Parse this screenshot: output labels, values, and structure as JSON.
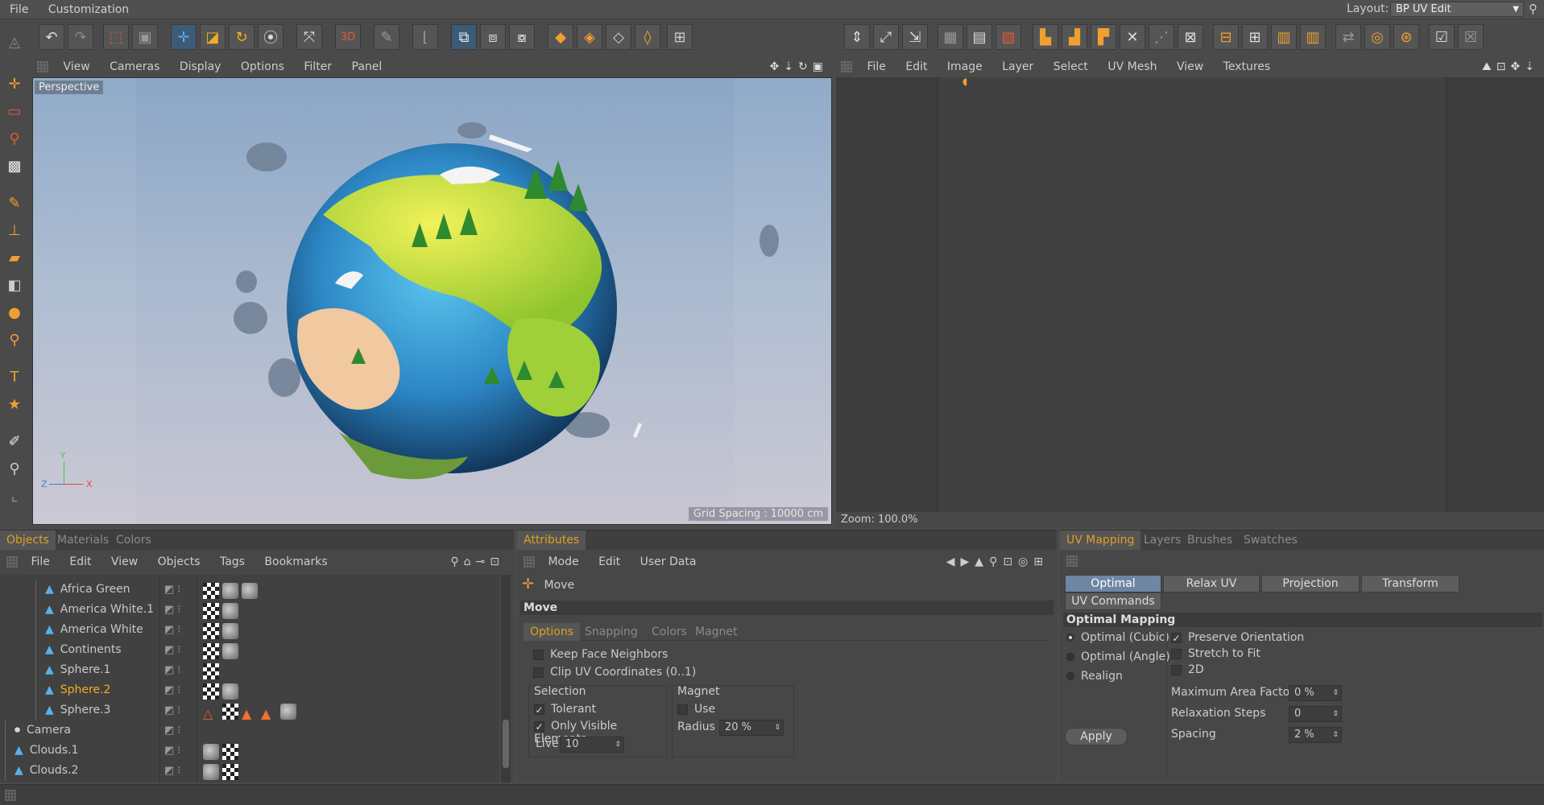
{
  "menubar": {
    "items": [
      "File",
      "Customization"
    ],
    "layout_label": "Layout:",
    "layout_value": "BP UV Edit"
  },
  "viewport": {
    "menu": [
      "View",
      "Cameras",
      "Display",
      "Options",
      "Filter",
      "Panel"
    ],
    "camera_label": "Perspective",
    "grid_spacing": "Grid Spacing : 10000 cm",
    "axis_labels": {
      "y": "Y",
      "z": "Z",
      "x": "X"
    }
  },
  "uv_view": {
    "menu": [
      "File",
      "Edit",
      "Image",
      "Layer",
      "Select",
      "UV Mesh",
      "View",
      "Textures"
    ],
    "zoom": "Zoom: 100.0%"
  },
  "objects_panel": {
    "tabs": [
      "Objects",
      "Materials",
      "Colors"
    ],
    "menu": [
      "File",
      "Edit",
      "View",
      "Objects",
      "Tags",
      "Bookmarks"
    ],
    "rows": [
      {
        "name": "Africa Green",
        "level": 2,
        "highlight": false,
        "icon": "polygon-object-icon",
        "tags": [
          "checker",
          "mat",
          "mat"
        ]
      },
      {
        "name": "America White.1",
        "level": 2,
        "highlight": false,
        "icon": "polygon-object-icon",
        "tags": [
          "checker",
          "mat"
        ]
      },
      {
        "name": "America White",
        "level": 2,
        "highlight": false,
        "icon": "polygon-object-icon",
        "tags": [
          "checker",
          "mat"
        ]
      },
      {
        "name": "Continents",
        "level": 2,
        "highlight": false,
        "icon": "polygon-object-icon",
        "tags": [
          "checker",
          "mat"
        ]
      },
      {
        "name": "Sphere.1",
        "level": 2,
        "highlight": false,
        "icon": "polygon-object-icon",
        "tags": [
          "checker"
        ]
      },
      {
        "name": "Sphere.2",
        "level": 2,
        "highlight": true,
        "icon": "polygon-object-icon",
        "tags": [
          "checker",
          "mat"
        ]
      },
      {
        "name": "Sphere.3",
        "level": 2,
        "highlight": false,
        "icon": "polygon-object-icon",
        "tags": [
          "warning",
          "checker",
          "warning-solid",
          "warning-solid",
          "mat"
        ]
      },
      {
        "name": "Camera",
        "level": 1,
        "highlight": false,
        "icon": "camera-icon",
        "tags": []
      },
      {
        "name": "Clouds.1",
        "level": 1,
        "highlight": false,
        "icon": "polygon-object-icon",
        "tags": [
          "mat",
          "checker"
        ]
      },
      {
        "name": "Clouds.2",
        "level": 1,
        "highlight": false,
        "icon": "polygon-object-icon",
        "tags": [
          "mat",
          "checker"
        ]
      }
    ]
  },
  "attributes_panel": {
    "tab": "Attributes",
    "menu": [
      "Mode",
      "Edit",
      "User Data"
    ],
    "tool_name": "Move",
    "section": "Move",
    "subtabs": [
      "Options",
      "Snapping",
      "Colors",
      "Magnet"
    ],
    "options": {
      "keep_face_neighbors": "Keep Face Neighbors",
      "clip_uv": "Clip UV Coordinates (0..1)",
      "selection_group": "Selection",
      "tolerant": "Tolerant",
      "only_visible": "Only Visible Elements",
      "live_label": "Live",
      "live_value": "10",
      "magnet_group": "Magnet",
      "use_label": "Use",
      "radius_label": "Radius",
      "radius_value": "20 %"
    }
  },
  "uv_panel": {
    "tabs": [
      "UV Mapping",
      "Layers",
      "Brushes",
      "Swatches"
    ],
    "buttons": [
      "Optimal Mapping",
      "Relax UV",
      "Projection",
      "Transform"
    ],
    "commands_button": "UV Commands",
    "section": "Optimal Mapping",
    "radios": [
      "Optimal (Cubic)",
      "Optimal (Angle)",
      "Realign"
    ],
    "checks": [
      {
        "label": "Preserve Orientation",
        "checked": true
      },
      {
        "label": "Stretch to Fit",
        "checked": false
      },
      {
        "label": "2D",
        "checked": false
      }
    ],
    "fields": [
      {
        "label": "Maximum Area Factor",
        "value": "0 %"
      },
      {
        "label": "Relaxation Steps",
        "value": "0"
      },
      {
        "label": "Spacing",
        "value": "2 %"
      }
    ],
    "apply_button": "Apply"
  }
}
